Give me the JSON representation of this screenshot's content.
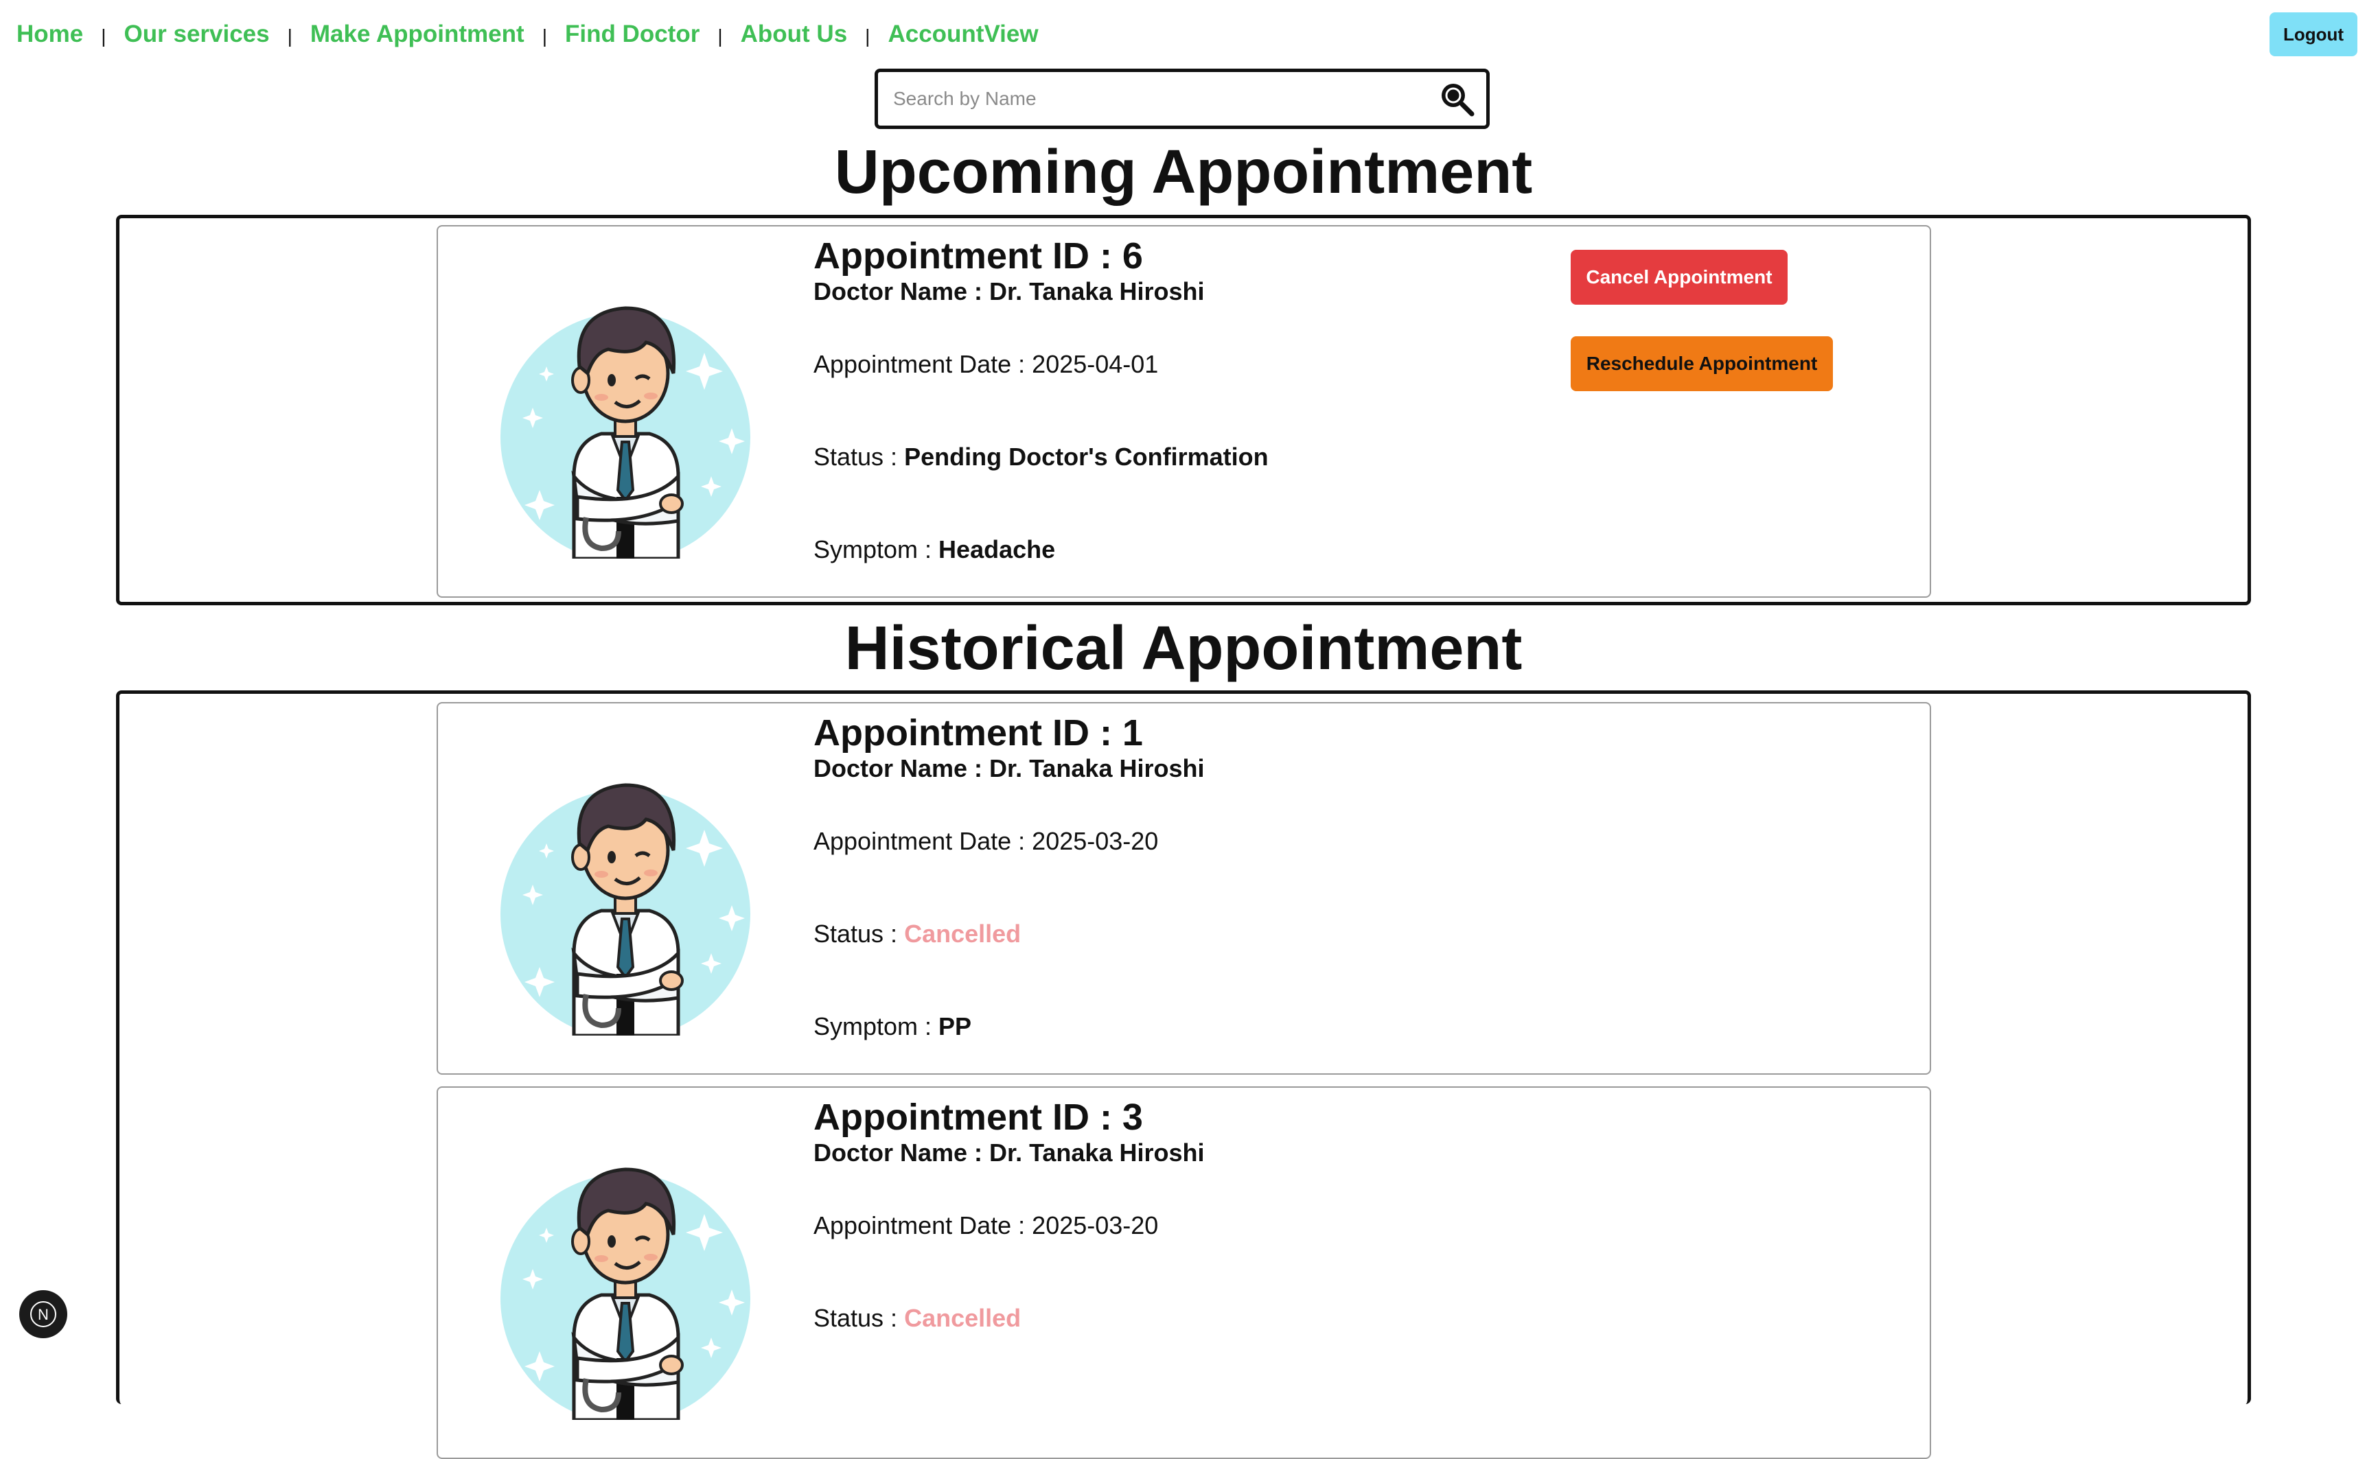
{
  "nav": {
    "items": [
      {
        "label": "Home"
      },
      {
        "label": "Our services"
      },
      {
        "label": "Make Appointment"
      },
      {
        "label": "Find Doctor"
      },
      {
        "label": "About Us"
      },
      {
        "label": "AccountView"
      }
    ],
    "separator": "|",
    "logout_label": "Logout"
  },
  "search": {
    "placeholder": "Search by Name",
    "icon": "magnifier-icon"
  },
  "upcoming": {
    "title": "Upcoming Appointment",
    "appointments": [
      {
        "id_label": "Appointment ID : 6",
        "doctor_label": "Doctor Name : Dr. Tanaka Hiroshi",
        "date_label": "Appointment Date : 2025-04-01",
        "status_prefix": "Status : ",
        "status": "Pending Doctor's Confirmation",
        "symptom_prefix": "Symptom : ",
        "symptom": "Headache",
        "cancel_label": "Cancel Appointment",
        "reschedule_label": "Reschedule Appointment"
      }
    ]
  },
  "historical": {
    "title": "Historical Appointment",
    "appointments": [
      {
        "id_label": "Appointment ID : 1",
        "doctor_label": "Doctor Name : Dr. Tanaka Hiroshi",
        "date_label": "Appointment Date : 2025-03-20",
        "status_prefix": "Status : ",
        "status": "Cancelled",
        "symptom_prefix": "Symptom : ",
        "symptom": "PP"
      },
      {
        "id_label": "Appointment ID : 3",
        "doctor_label": "Doctor Name : Dr. Tanaka Hiroshi",
        "date_label": "Appointment Date : 2025-03-20",
        "status_prefix": "Status : ",
        "status": "Cancelled"
      }
    ]
  },
  "colors": {
    "nav_link": "#3fbf55",
    "logout_bg": "#7fe0f7",
    "cancel_bg": "#e53c3f",
    "reschedule_bg": "#f07a15",
    "cancelled_status": "#f09a9e",
    "avatar_circle": "#bdeef2"
  },
  "dev_badge": {
    "letter": "N",
    "icon": "nextjs-icon"
  }
}
